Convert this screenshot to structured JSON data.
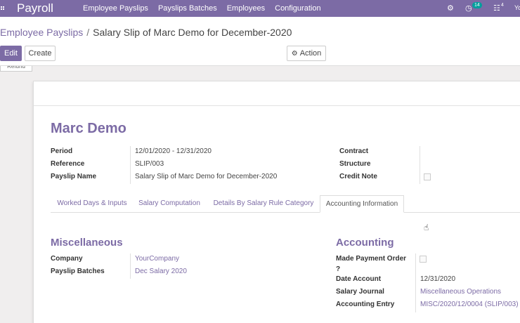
{
  "navbar": {
    "brand": "Payroll",
    "menu": [
      "Employee Payslips",
      "Payslips Batches",
      "Employees",
      "Configuration"
    ],
    "activity_badge": "14",
    "messages_badge": "4",
    "user_initials": "Yo"
  },
  "breadcrumb": {
    "parent": "Employee Payslips",
    "separator": "/",
    "current": "Salary Slip of Marc Demo for December-2020"
  },
  "buttons": {
    "edit": "Edit",
    "create": "Create",
    "action": "Action",
    "refund": "Refund"
  },
  "record": {
    "employee": "Marc Demo",
    "left_fields": [
      {
        "label": "Period",
        "value": "12/01/2020 - 12/31/2020"
      },
      {
        "label": "Reference",
        "value": "SLIP/003"
      },
      {
        "label": "Payslip Name",
        "value": "Salary Slip of Marc Demo for December-2020"
      }
    ],
    "right_fields": [
      {
        "label": "Contract",
        "value": ""
      },
      {
        "label": "Structure",
        "value": ""
      },
      {
        "label": "Credit Note",
        "value": ""
      }
    ]
  },
  "tabs": [
    {
      "label": "Worked Days & Inputs",
      "active": false
    },
    {
      "label": "Salary Computation",
      "active": false
    },
    {
      "label": "Details By Salary Rule Category",
      "active": false
    },
    {
      "label": "Accounting Information",
      "active": true
    }
  ],
  "miscellaneous": {
    "title": "Miscellaneous",
    "fields": [
      {
        "label": "Company",
        "value": "YourCompany"
      },
      {
        "label": "Payslip Batches",
        "value": "Dec Salary 2020"
      }
    ]
  },
  "accounting": {
    "title": "Accounting",
    "made_payment_order_line1": "Made Payment Order",
    "made_payment_order_line2": "?",
    "fields": [
      {
        "label": "Date Account",
        "value": "12/31/2020"
      },
      {
        "label": "Salary Journal",
        "value": "Miscellaneous Operations"
      },
      {
        "label": "Accounting Entry",
        "value": "MISC/2020/12/0004 (SLIP/003)"
      }
    ]
  },
  "colors": {
    "brand": "#7c6ba5",
    "badge": "#00a09d"
  },
  "icons": [
    "apps-icon",
    "bug-icon",
    "clock-icon",
    "chat-icon",
    "gear-icon",
    "hand-cursor-icon"
  ]
}
